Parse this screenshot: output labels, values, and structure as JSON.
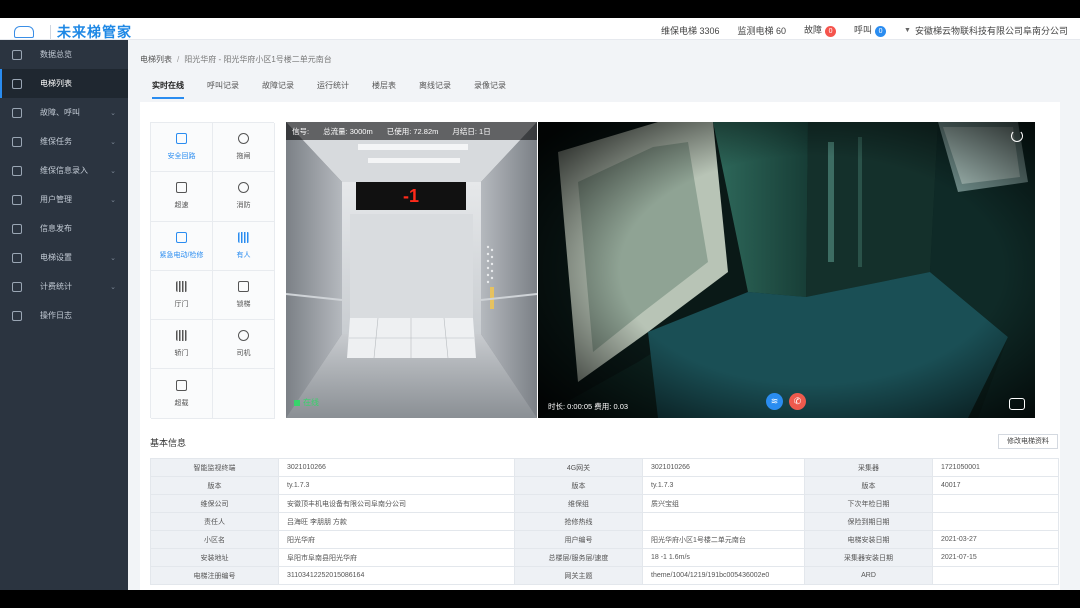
{
  "app": {
    "name": "未来梯管家"
  },
  "header": {
    "maintenance_label": "维保电梯 3306",
    "monitor_label": "监测电梯 60",
    "fault_label": "故障",
    "fault_count": "0",
    "call_label": "呼叫",
    "call_count": "0",
    "company": "安徽梯云物联科技有限公司阜南分公司"
  },
  "sidebar": {
    "items": [
      {
        "label": "数据总览",
        "icon": "dashboard-icon",
        "chevron": ""
      },
      {
        "label": "电梯列表",
        "icon": "list-icon",
        "chevron": ""
      },
      {
        "label": "故障、呼叫",
        "icon": "alert-icon",
        "chevron": "⌄"
      },
      {
        "label": "维保任务",
        "icon": "task-icon",
        "chevron": "⌄"
      },
      {
        "label": "维保信息录入",
        "icon": "form-icon",
        "chevron": "⌄"
      },
      {
        "label": "用户管理",
        "icon": "user-icon",
        "chevron": "⌄"
      },
      {
        "label": "信息发布",
        "icon": "publish-icon",
        "chevron": ""
      },
      {
        "label": "电梯设置",
        "icon": "settings-icon",
        "chevron": "⌄"
      },
      {
        "label": "计费统计",
        "icon": "billing-icon",
        "chevron": "⌄"
      },
      {
        "label": "操作日志",
        "icon": "log-icon",
        "chevron": ""
      }
    ]
  },
  "breadcrumb": {
    "root": "电梯列表",
    "sep": "/",
    "current": "阳光华府 - 阳光华府小区1号楼二单元南台"
  },
  "tabs": [
    "实时在线",
    "呼叫记录",
    "故障记录",
    "运行统计",
    "楼层表",
    "离线记录",
    "录像记录"
  ],
  "functions": [
    {
      "label": "安全回路",
      "active": true
    },
    {
      "label": "拖闸",
      "active": false
    },
    {
      "label": "超速",
      "active": false
    },
    {
      "label": "消防",
      "active": false
    },
    {
      "label": "紧急电动/检修",
      "active": true
    },
    {
      "label": "有人",
      "active": true
    },
    {
      "label": "厅门",
      "active": false
    },
    {
      "label": "锁梯",
      "active": false
    },
    {
      "label": "轿门",
      "active": false
    },
    {
      "label": "司机",
      "active": false
    },
    {
      "label": "超载",
      "active": false
    },
    {
      "label": "",
      "active": false
    }
  ],
  "camera1": {
    "signal": "信号:",
    "total_flow": "总流量: 3000m",
    "used": "已使用: 72.82m",
    "month_end": "月结日: 1日",
    "floor": "-1",
    "status": "在线"
  },
  "camera2": {
    "stats": "时长: 0:00:05  费用: 0.03"
  },
  "basic_info": {
    "title": "基本信息",
    "edit_button": "修改电梯资料",
    "rows": [
      [
        "智能监视终端",
        "3021010266",
        "4G网关",
        "3021010266",
        "采集器",
        "1721050001"
      ],
      [
        "版本",
        "ty.1.7.3",
        "版本",
        "ty.1.7.3",
        "版本",
        "40017"
      ],
      [
        "维保公司",
        "安徽顶丰机电设备有限公司阜南分公司",
        "维保组",
        "质兴宝组",
        "下次年检日期",
        ""
      ],
      [
        "责任人",
        "吕海旺 李朋朋 方款",
        "抢修热线",
        "",
        "保险到期日期",
        ""
      ],
      [
        "小区名",
        "阳光华府",
        "用户编号",
        "阳光华府小区1号楼二单元南台",
        "电梯安装日期",
        "2021-03-27"
      ],
      [
        "安装地址",
        "阜阳市阜南县阳光华府",
        "总楼层/服务层/速度",
        "18 -1 1.6m/s",
        "采集器安装日期",
        "2021-07-15"
      ],
      [
        "电梯注册编号",
        "31103412252015086164",
        "网关主题",
        "theme/1004/1219/191bc005436002e0",
        "ARD",
        ""
      ]
    ]
  }
}
